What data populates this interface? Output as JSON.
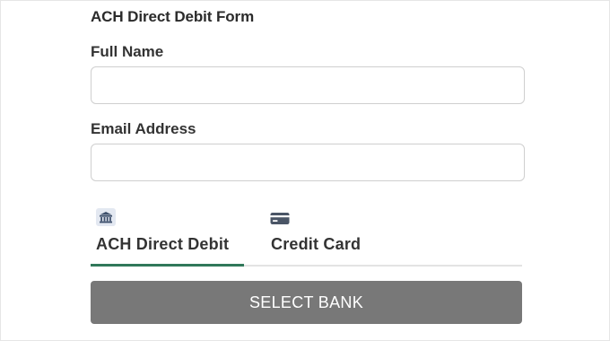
{
  "form": {
    "title": "ACH Direct Debit Form",
    "full_name_label": "Full Name",
    "full_name_value": "",
    "email_label": "Email Address",
    "email_value": ""
  },
  "tabs": [
    {
      "label": "ACH Direct Debit",
      "icon": "bank-icon",
      "selected": true
    },
    {
      "label": "Credit Card",
      "icon": "credit-card-icon",
      "selected": false
    }
  ],
  "actions": {
    "select_bank_label": "SELECT BANK"
  },
  "colors": {
    "active_tab_underline": "#30785a",
    "button_background": "#787878",
    "button_text": "#ffffff",
    "input_border": "#cfcfcf",
    "icon_color": "#3d4f6b"
  }
}
